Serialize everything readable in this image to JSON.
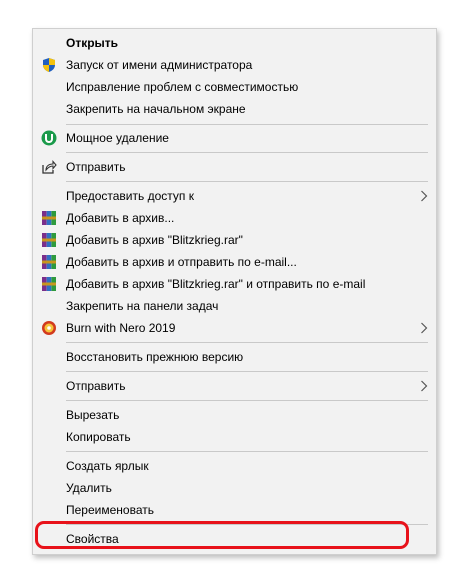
{
  "menu": {
    "items": [
      {
        "label": "Открыть"
      },
      {
        "label": "Запуск от имени администратора",
        "icon": "shield-icon"
      },
      {
        "label": "Исправление проблем с совместимостью"
      },
      {
        "label": "Закрепить на начальном экране"
      },
      {
        "label": "Мощное удаление",
        "icon": "uninstall-icon"
      },
      {
        "label": "Отправить",
        "icon": "share-icon"
      },
      {
        "label": "Предоставить доступ к",
        "submenu": true
      },
      {
        "label": "Добавить в архив...",
        "icon": "winrar-icon"
      },
      {
        "label": "Добавить в архив \"Blitzkrieg.rar\"",
        "icon": "winrar-icon"
      },
      {
        "label": "Добавить в архив и отправить по e-mail...",
        "icon": "winrar-icon"
      },
      {
        "label": "Добавить в архив \"Blitzkrieg.rar\" и отправить по e-mail",
        "icon": "winrar-icon"
      },
      {
        "label": "Закрепить на панели задач"
      },
      {
        "label": "Burn with Nero 2019",
        "icon": "nero-icon",
        "submenu": true
      },
      {
        "label": "Восстановить прежнюю версию"
      },
      {
        "label": "Отправить",
        "submenu": true
      },
      {
        "label": "Вырезать"
      },
      {
        "label": "Копировать"
      },
      {
        "label": "Создать ярлык"
      },
      {
        "label": "Удалить"
      },
      {
        "label": "Переименовать"
      },
      {
        "label": "Свойства"
      }
    ]
  },
  "colors": {
    "highlight": "#e8121a",
    "menu_background": "#f2f2f2",
    "separator": "#c9c9c9"
  }
}
